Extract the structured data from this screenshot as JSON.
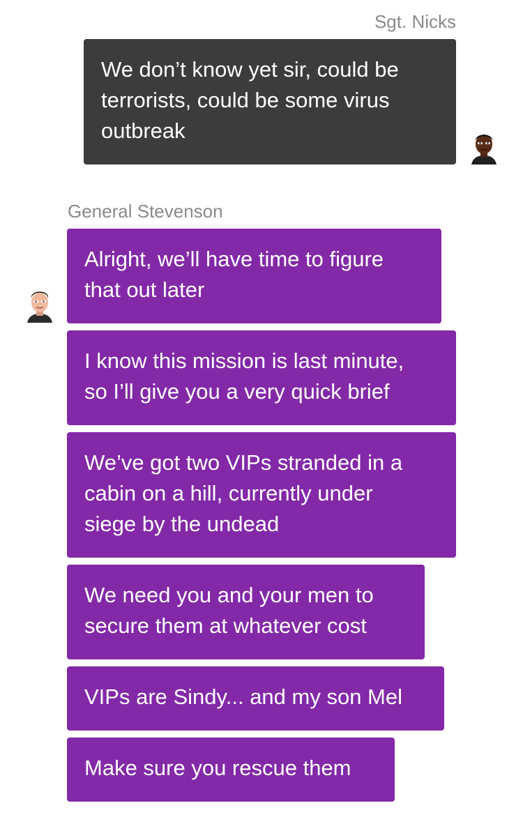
{
  "colors": {
    "incoming_bubble": "#3c3c3c",
    "outgoing_bubble": "#8329a8",
    "sender_name": "#8a8a8a",
    "bubble_text": "#ffffff",
    "background": "#ffffff"
  },
  "conversation": {
    "groups": [
      {
        "sender": "Sgt. Nicks",
        "avatar_icon": "soldier-avatar-icon",
        "messages": [
          {
            "lines": [
              "We don’t know yet sir, could be",
              "terrorists, could be some virus",
              "outbreak"
            ]
          }
        ]
      },
      {
        "sender": "General Stevenson",
        "avatar_icon": "general-avatar-icon",
        "messages": [
          {
            "lines": [
              "Alright, we’ll have time to figure",
              "that out later"
            ]
          },
          {
            "lines": [
              "I know this mission is last minute,",
              "so I’ll give you a very quick brief"
            ]
          },
          {
            "lines": [
              "We’ve got two VIPs stranded in a",
              "cabin on a hill, currently under",
              "siege by the undead"
            ]
          },
          {
            "lines": [
              "We need you and your men to",
              "secure them at whatever cost"
            ]
          },
          {
            "lines": [
              "VIPs are Sindy... and my son Mel"
            ]
          },
          {
            "lines": [
              "Make sure you rescue them"
            ]
          }
        ]
      }
    ]
  }
}
